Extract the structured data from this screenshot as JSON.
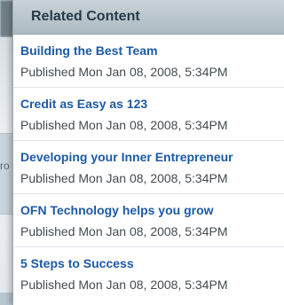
{
  "background": {
    "edge_text": "ro"
  },
  "related_content": {
    "title": "Related Content",
    "items": [
      {
        "title": "Building the Best Team",
        "meta": "Published Mon Jan 08, 2008, 5:34PM"
      },
      {
        "title": "Credit as Easy as 123",
        "meta": "Published Mon Jan 08, 2008, 5:34PM"
      },
      {
        "title": "Developing your Inner Entrepreneur",
        "meta": "Published Mon Jan 08, 2008, 5:34PM"
      },
      {
        "title": "OFN Technology helps you grow",
        "meta": "Published Mon Jan 08, 2008, 5:34PM"
      },
      {
        "title": "5 Steps to Success",
        "meta": "Published Mon Jan 08, 2008, 5:34PM"
      }
    ]
  },
  "colors": {
    "link": "#1c5aa6",
    "header_bg": "#b9c5cc",
    "meta_text": "#444a4f"
  }
}
